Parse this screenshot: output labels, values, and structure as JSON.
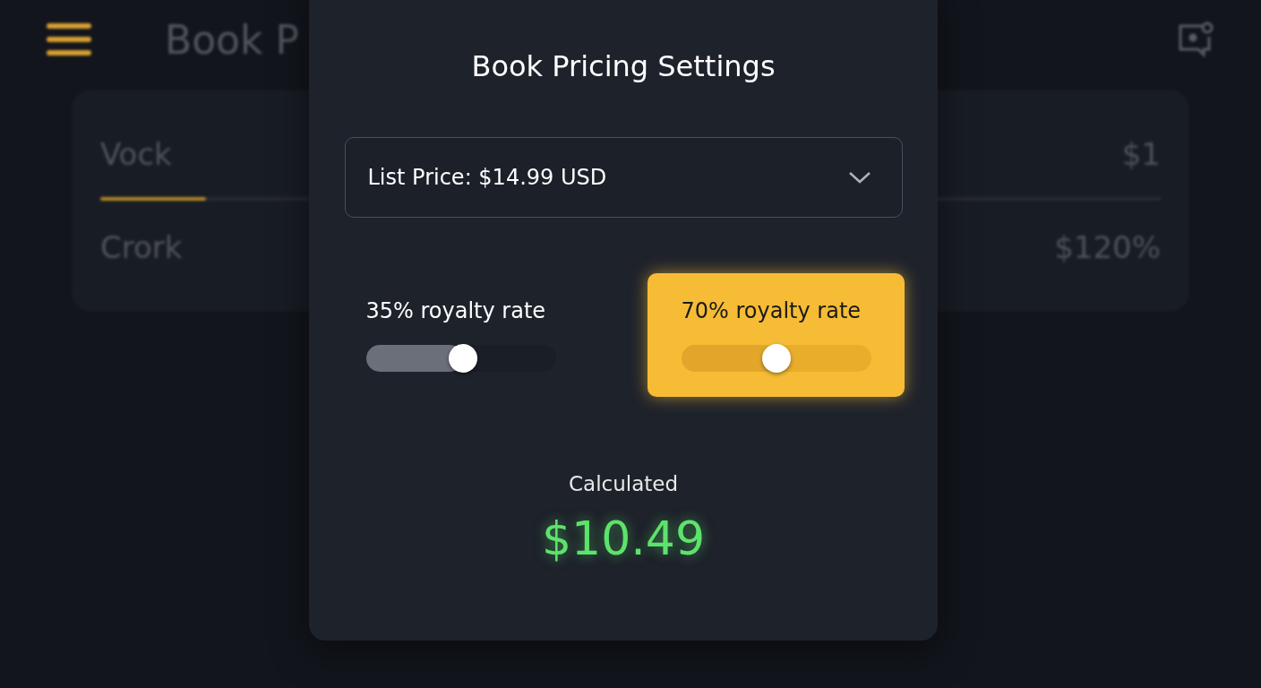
{
  "background": {
    "title": "Book P",
    "rows": [
      {
        "name": "Vock",
        "value": "$1",
        "level": 0.1
      },
      {
        "name": "Crork",
        "value": "$120%"
      }
    ]
  },
  "dialog": {
    "title": "Book Pricing Settings",
    "price_select": {
      "value": "List Price: $14.99 USD"
    },
    "royalty_options": [
      {
        "label": "35% royalty rate",
        "level": 0.51,
        "selected": false
      },
      {
        "label": "70% royalty rate",
        "level": 0.5,
        "selected": true
      }
    ],
    "result": {
      "label": "Calculated",
      "value": "$10.49"
    }
  }
}
